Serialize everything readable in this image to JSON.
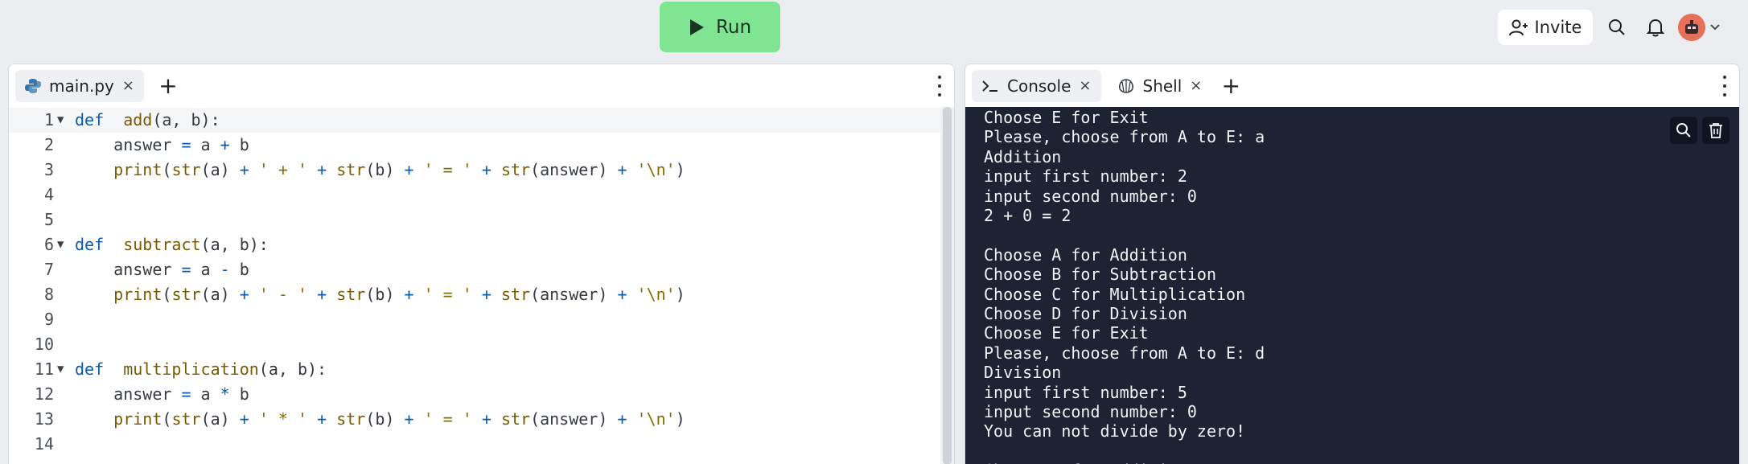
{
  "topbar": {
    "run_label": "Run",
    "invite_label": "Invite",
    "accent": "#7fe592"
  },
  "editor": {
    "tabs": [
      {
        "label": "main.py",
        "close": "×"
      }
    ],
    "add_tab": "+",
    "lines": [
      {
        "n": "1",
        "fold": "▼"
      },
      {
        "n": "2",
        "fold": ""
      },
      {
        "n": "3",
        "fold": ""
      },
      {
        "n": "4",
        "fold": ""
      },
      {
        "n": "5",
        "fold": ""
      },
      {
        "n": "6",
        "fold": "▼"
      },
      {
        "n": "7",
        "fold": ""
      },
      {
        "n": "8",
        "fold": ""
      },
      {
        "n": "9",
        "fold": ""
      },
      {
        "n": "10",
        "fold": ""
      },
      {
        "n": "11",
        "fold": "▼"
      },
      {
        "n": "12",
        "fold": ""
      },
      {
        "n": "13",
        "fold": ""
      },
      {
        "n": "14",
        "fold": ""
      }
    ],
    "code": [
      [
        [
          "kw",
          "def"
        ],
        [
          "",
          "  "
        ],
        [
          "fn",
          "add"
        ],
        [
          "",
          "(a, b):"
        ]
      ],
      [
        [
          "",
          "    answer "
        ],
        [
          "op",
          "="
        ],
        [
          "",
          " a "
        ],
        [
          "op",
          "+"
        ],
        [
          "",
          " b"
        ]
      ],
      [
        [
          "",
          "    "
        ],
        [
          "fn",
          "print"
        ],
        [
          "",
          "("
        ],
        [
          "fn",
          "str"
        ],
        [
          "",
          "(a) "
        ],
        [
          "op",
          "+"
        ],
        [
          "",
          " "
        ],
        [
          "str",
          "' + '"
        ],
        [
          "",
          " "
        ],
        [
          "op",
          "+"
        ],
        [
          "",
          " "
        ],
        [
          "fn",
          "str"
        ],
        [
          "",
          "(b) "
        ],
        [
          "op",
          "+"
        ],
        [
          "",
          " "
        ],
        [
          "str",
          "' = '"
        ],
        [
          "",
          " "
        ],
        [
          "op",
          "+"
        ],
        [
          "",
          " "
        ],
        [
          "fn",
          "str"
        ],
        [
          "",
          "(answer) "
        ],
        [
          "op",
          "+"
        ],
        [
          "",
          " "
        ],
        [
          "str",
          "'\\n'"
        ],
        [
          "",
          ")"
        ]
      ],
      [],
      [],
      [
        [
          "kw",
          "def"
        ],
        [
          "",
          "  "
        ],
        [
          "fn",
          "subtract"
        ],
        [
          "",
          "(a, b):"
        ]
      ],
      [
        [
          "",
          "    answer "
        ],
        [
          "op",
          "="
        ],
        [
          "",
          " a "
        ],
        [
          "op",
          "-"
        ],
        [
          "",
          " b"
        ]
      ],
      [
        [
          "",
          "    "
        ],
        [
          "fn",
          "print"
        ],
        [
          "",
          "("
        ],
        [
          "fn",
          "str"
        ],
        [
          "",
          "(a) "
        ],
        [
          "op",
          "+"
        ],
        [
          "",
          " "
        ],
        [
          "str",
          "' - '"
        ],
        [
          "",
          " "
        ],
        [
          "op",
          "+"
        ],
        [
          "",
          " "
        ],
        [
          "fn",
          "str"
        ],
        [
          "",
          "(b) "
        ],
        [
          "op",
          "+"
        ],
        [
          "",
          " "
        ],
        [
          "str",
          "' = '"
        ],
        [
          "",
          " "
        ],
        [
          "op",
          "+"
        ],
        [
          "",
          " "
        ],
        [
          "fn",
          "str"
        ],
        [
          "",
          "(answer) "
        ],
        [
          "op",
          "+"
        ],
        [
          "",
          " "
        ],
        [
          "str",
          "'\\n'"
        ],
        [
          "",
          ")"
        ]
      ],
      [],
      [],
      [
        [
          "kw",
          "def"
        ],
        [
          "",
          "  "
        ],
        [
          "fn",
          "multiplication"
        ],
        [
          "",
          "(a, b):"
        ]
      ],
      [
        [
          "",
          "    answer "
        ],
        [
          "op",
          "="
        ],
        [
          "",
          " a "
        ],
        [
          "op",
          "*"
        ],
        [
          "",
          " b"
        ]
      ],
      [
        [
          "",
          "    "
        ],
        [
          "fn",
          "print"
        ],
        [
          "",
          "("
        ],
        [
          "fn",
          "str"
        ],
        [
          "",
          "(a) "
        ],
        [
          "op",
          "+"
        ],
        [
          "",
          " "
        ],
        [
          "str",
          "' * '"
        ],
        [
          "",
          " "
        ],
        [
          "op",
          "+"
        ],
        [
          "",
          " "
        ],
        [
          "fn",
          "str"
        ],
        [
          "",
          "(b) "
        ],
        [
          "op",
          "+"
        ],
        [
          "",
          " "
        ],
        [
          "str",
          "' = '"
        ],
        [
          "",
          " "
        ],
        [
          "op",
          "+"
        ],
        [
          "",
          " "
        ],
        [
          "fn",
          "str"
        ],
        [
          "",
          "(answer) "
        ],
        [
          "op",
          "+"
        ],
        [
          "",
          " "
        ],
        [
          "str",
          "'\\n'"
        ],
        [
          "",
          ")"
        ]
      ],
      []
    ]
  },
  "console": {
    "tabs": [
      {
        "label": "Console",
        "close": "×"
      },
      {
        "label": "Shell",
        "close": "×"
      }
    ],
    "add_tab": "+",
    "output": [
      "Choose E for Exit",
      "Please, choose from A to E: a",
      "Addition",
      "input first number: 2",
      "input second number: 0",
      "2 + 0 = 2",
      "",
      "Choose A for Addition",
      "Choose B for Subtraction",
      "Choose C for Multiplication",
      "Choose D for Division",
      "Choose E for Exit",
      "Please, choose from A to E: d",
      "Division",
      "input first number: 5",
      "input second number: 0",
      "You can not divide by zero!",
      "",
      "Choose A for Addition"
    ]
  }
}
